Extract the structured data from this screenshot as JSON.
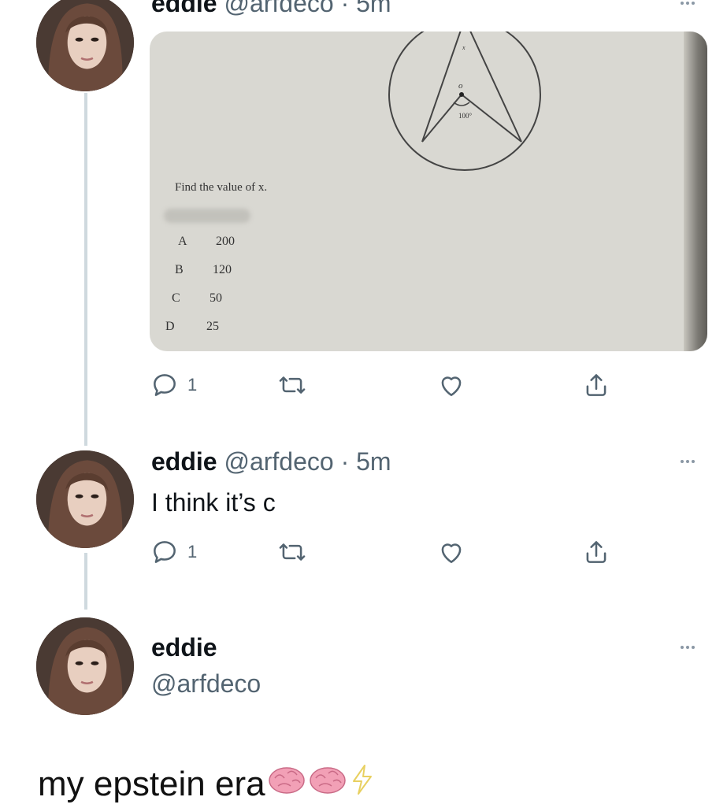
{
  "tweets": [
    {
      "display_name": "eddie",
      "handle": "@arfdeco",
      "separator": "·",
      "time": "5m",
      "image": {
        "question": "Find the value of x.",
        "angle_label": "100°",
        "center_label": "o",
        "vertex_label": "x",
        "options": [
          {
            "letter": "A",
            "value": "200"
          },
          {
            "letter": "B",
            "value": "120"
          },
          {
            "letter": "C",
            "value": "50"
          },
          {
            "letter": "D",
            "value": "25"
          }
        ]
      },
      "reply_count": "1"
    },
    {
      "display_name": "eddie",
      "handle": "@arfdeco",
      "separator": "·",
      "time": "5m",
      "text": "I think it’s c",
      "reply_count": "1"
    },
    {
      "display_name": "eddie",
      "handle": "@arfdeco"
    }
  ],
  "caption": {
    "text": "my epstein era",
    "emojis": [
      "brain-icon",
      "brain-icon",
      "lightning-icon"
    ]
  },
  "colors": {
    "text": "#0f1419",
    "muted": "#536471",
    "thread_line": "#cfd9de",
    "icon": "#536471"
  }
}
